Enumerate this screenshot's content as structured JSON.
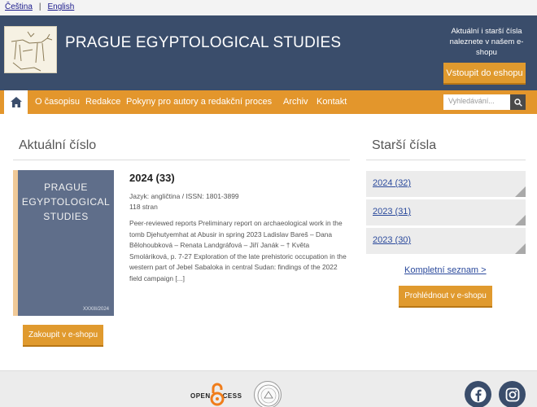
{
  "lang_bar": {
    "czech": "Čeština",
    "separator": "|",
    "english": "English"
  },
  "header": {
    "title": "PRAGUE EGYPTOLOGICAL STUDIES",
    "shop_note": "Aktuální i starší čísla naleznete v našem e-shopu",
    "shop_button": "Vstoupit do eshopu"
  },
  "nav": {
    "items": [
      "O časopisu",
      "Redakce",
      "Pokyny pro autory a redakční proces",
      "Archiv",
      "Kontakt"
    ],
    "search_placeholder": "Vyhledávání..."
  },
  "current": {
    "section_title": "Aktuální číslo",
    "cover_title_lines": [
      "PRAGUE",
      "EGYPTOLOGICAL",
      "STUDIES"
    ],
    "cover_volume": "XXXIII/2024",
    "issue": "2024 (33)",
    "language_issn": "Jazyk: angličtina / ISSN: 1801-3899",
    "pages": "118 stran",
    "abstract": "Peer-reviewed reports Preliminary report on archaeological work in the tomb Djehutyemhat at Abusir in spring 2023 Ladislav Bareš – Dana Bělohoubková – Renata Landgráfová – Jiří Janák – † Květa Smoláriková, p. 7-27 Exploration of the late prehistoric occupation in the western part of Jebel Sabaloka in central Sudan: findings of the 2022 field campaign [...]",
    "buy_button": "Zakoupit v e-shopu"
  },
  "older": {
    "section_title": "Starší čísla",
    "items": [
      "2024 (32)",
      "2023 (31)",
      "2023 (30)"
    ],
    "full_list": "Kompletní seznam >",
    "eshop_button": "Prohlédnout v e-shopu"
  },
  "footer": {
    "open_access_label": "OPEN ACCESS"
  },
  "colors": {
    "header_bg": "#3a4d6b",
    "accent": "#e3962c",
    "link": "#2b4a9c"
  }
}
